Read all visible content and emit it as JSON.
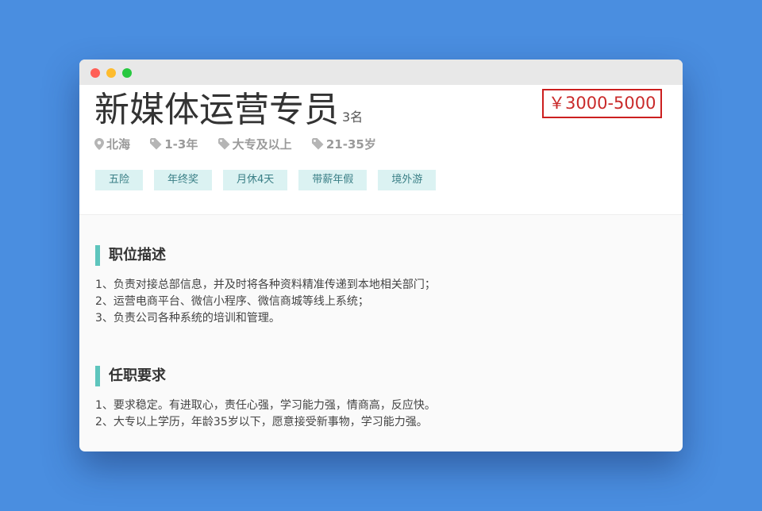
{
  "job": {
    "title": "新媒体运营专员",
    "headcount": "3名",
    "salary": "￥3000-5000",
    "meta": {
      "location": "北海",
      "experience": "1-3年",
      "education": "大专及以上",
      "age": "21-35岁"
    },
    "benefits": [
      "五险",
      "年终奖",
      "月休4天",
      "带薪年假",
      "境外游"
    ]
  },
  "sections": {
    "description": {
      "title": "职位描述",
      "lines": [
        "1、负责对接总部信息，并及时将各种资料精准传递到本地相关部门；",
        "2、运营电商平台、微信小程序、微信商城等线上系统；",
        "3、负责公司各种系统的培训和管理。"
      ]
    },
    "requirements": {
      "title": "任职要求",
      "lines": [
        "1、要求稳定。有进取心，责任心强，学习能力强，情商高，反应快。",
        "2、大专以上学历，年龄35岁以下，愿意接受新事物，学习能力强。"
      ]
    }
  },
  "icons": {
    "location": "map-pin-icon",
    "tag": "tag-icon"
  },
  "colors": {
    "background": "#4a8ee0",
    "accent_bar": "#5ec5bd",
    "tag_bg": "#dbf2f2",
    "salary_red": "#cc1f1f"
  }
}
